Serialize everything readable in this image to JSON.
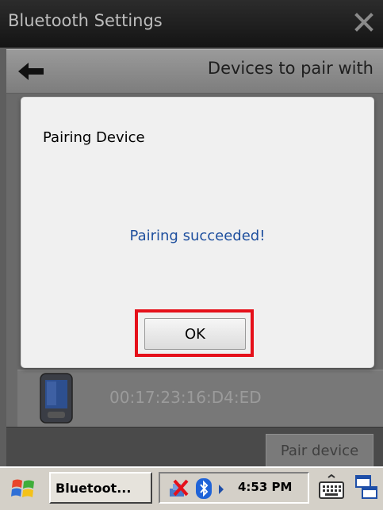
{
  "window": {
    "title": "Bluetooth Settings"
  },
  "navbar": {
    "heading": "Devices to pair with"
  },
  "device_list": {
    "items": [
      {
        "address": "00:17:23:16:D4:ED",
        "icon": "pda-device-icon"
      }
    ]
  },
  "command_bar": {
    "pair_label": "Pair device"
  },
  "dialog": {
    "title": "Pairing Device",
    "message": "Pairing succeeded!",
    "ok_label": "OK"
  },
  "taskbar": {
    "active_task": "Bluetoot...",
    "clock": "4:53 PM",
    "icons": [
      "windows-start-icon",
      "network-disconnected-icon",
      "bluetooth-icon",
      "tray-arrow-icon",
      "keyboard-icon",
      "window-switch-icon"
    ]
  },
  "colors": {
    "highlight": "#e5101a",
    "message_text": "#1e4f9e"
  }
}
